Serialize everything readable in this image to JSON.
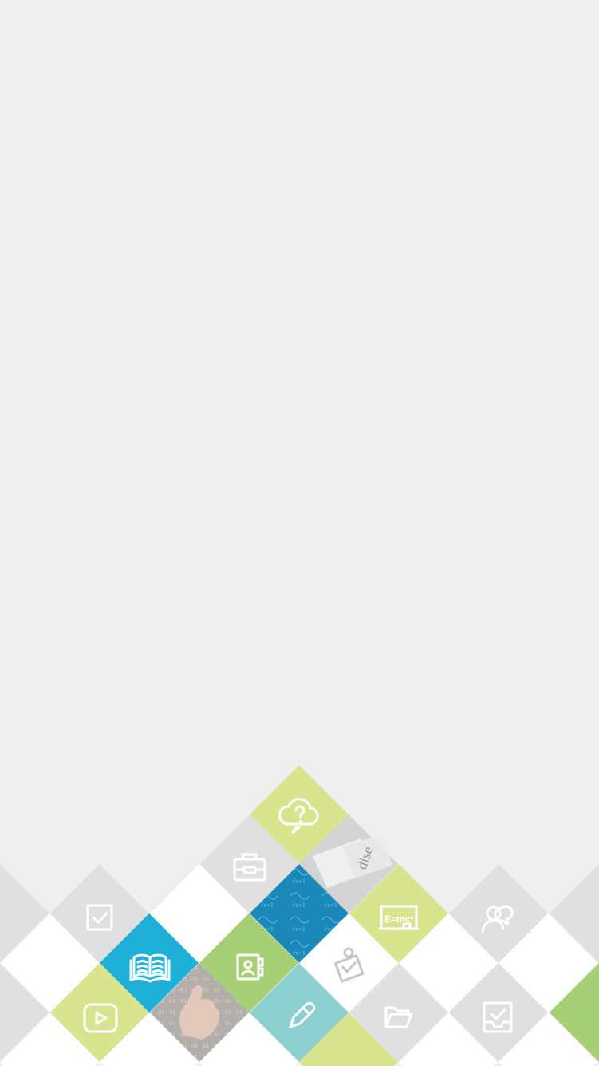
{
  "background_color": "#efefef",
  "palette": {
    "grey": "#e0e0e0",
    "white": "#ffffff",
    "lime": "#d9e48e",
    "green": "#a6cf76",
    "blue": "#1fb0d8",
    "teal": "#8ecfd0",
    "photo_blue": "#1a88b8",
    "photo_paper": "#d4d4d4",
    "photo_hand": "#b6aca6"
  },
  "icons": [
    {
      "name": "help-cloud-icon",
      "label": ""
    },
    {
      "name": "briefcase-icon",
      "label": ""
    },
    {
      "name": "checkbox-icon",
      "label": ""
    },
    {
      "name": "book-icon",
      "label": ""
    },
    {
      "name": "contacts-icon",
      "label": ""
    },
    {
      "name": "clipboard-check-icon",
      "label": ""
    },
    {
      "name": "blackboard-icon",
      "label": "E=mc²"
    },
    {
      "name": "users-icon",
      "label": ""
    },
    {
      "name": "video-play-icon",
      "label": ""
    },
    {
      "name": "pencil-icon",
      "label": ""
    },
    {
      "name": "folder-icon",
      "label": ""
    },
    {
      "name": "inbox-check-icon",
      "label": ""
    }
  ]
}
